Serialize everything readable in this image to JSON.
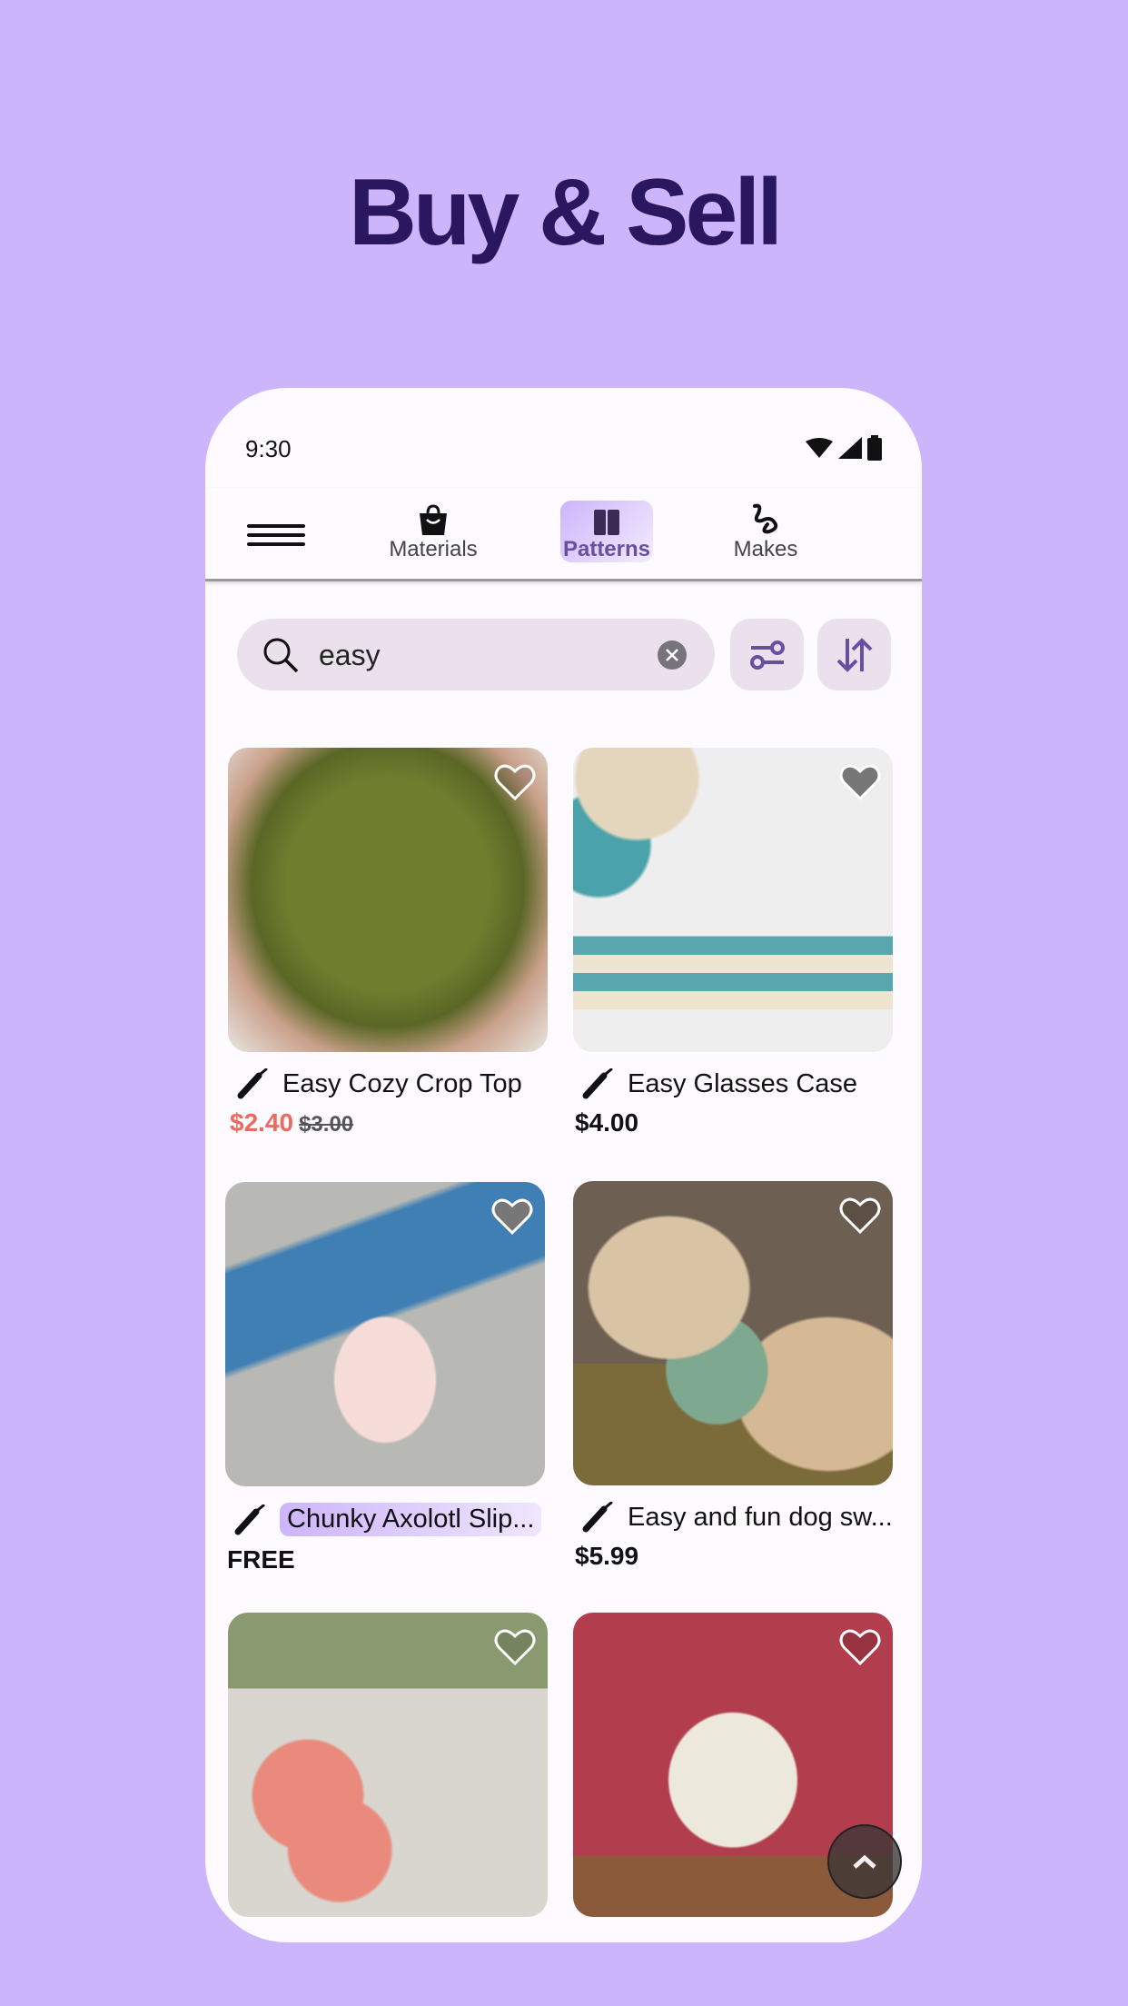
{
  "headline": "Buy & Sell",
  "status": {
    "time": "9:30",
    "icons": [
      "wifi-icon",
      "signal-icon",
      "battery-icon"
    ]
  },
  "nav": {
    "tabs": [
      {
        "label": "Materials",
        "icon": "shopping-bag-icon",
        "active": false
      },
      {
        "label": "Patterns",
        "icon": "book-icon",
        "active": true
      },
      {
        "label": "Makes",
        "icon": "yarn-squiggle-icon",
        "active": false
      }
    ]
  },
  "search": {
    "value": "easy",
    "icon": "search-icon",
    "clear_icon": "clear-icon"
  },
  "colors": {
    "background": "#cdb5fb",
    "accent": "#6a4fa0",
    "sale": "#ec6a5f",
    "headline": "#2b1760"
  },
  "listings": [
    {
      "title": "Easy Cozy Crop Top",
      "price": "$2.40",
      "original_price": "$3.00",
      "favorited": false
    },
    {
      "title": "Easy Glasses Case",
      "price": "$4.00",
      "favorited": true
    },
    {
      "title": "Chunky Axolotl Slip...",
      "price": "FREE",
      "favorited": true,
      "highlighted": true
    },
    {
      "title": "Easy and fun dog sw...",
      "price": "$5.99",
      "favorited": false
    },
    {
      "title": "",
      "price": "",
      "favorited": false
    },
    {
      "title": "",
      "price": "",
      "favorited": false
    }
  ]
}
